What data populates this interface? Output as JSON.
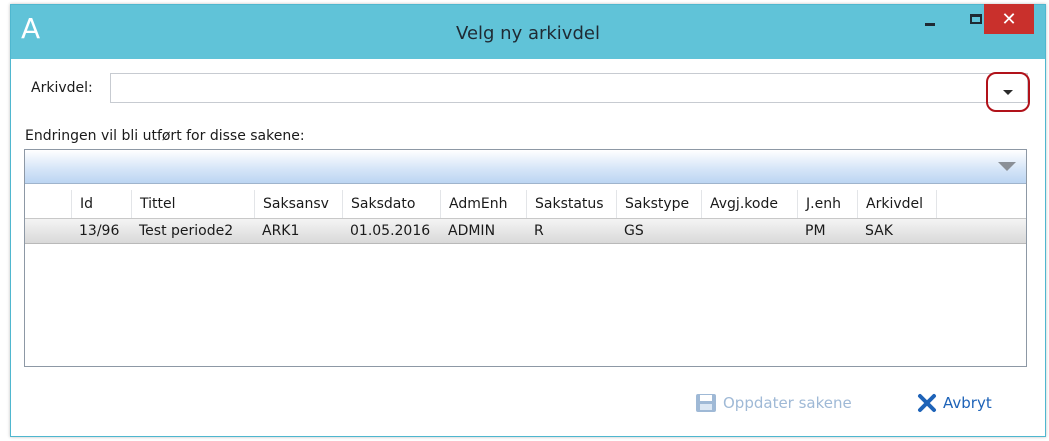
{
  "window": {
    "app_icon": "A",
    "title": "Velg ny arkivdel",
    "close_glyph": "✕"
  },
  "form": {
    "arkivdel_label": "Arkivdel:",
    "arkivdel_value": "",
    "changes_label": "Endringen vil bli utført for disse sakene:"
  },
  "grid": {
    "columns": [
      "Id",
      "Tittel",
      "Saksansv",
      "Saksdato",
      "AdmEnh",
      "Sakstatus",
      "Sakstype",
      "Avgj.kode",
      "J.enh",
      "Arkivdel"
    ],
    "rows": [
      [
        "13/96",
        "Test periode2",
        "ARK1",
        "01.05.2016",
        "ADMIN",
        "R",
        "GS",
        "",
        "PM",
        "SAK"
      ]
    ]
  },
  "buttons": {
    "update_label": "Oppdater sakene",
    "update_icon": "save-icon",
    "cancel_label": "Avbryt",
    "cancel_icon": "close-x-icon"
  },
  "colors": {
    "titlebar": "#60c3d8",
    "close_button": "#c9302c",
    "highlight": "#b1121a",
    "cancel_blue": "#1e63b8",
    "disabled_blue": "#9fb9d6"
  }
}
